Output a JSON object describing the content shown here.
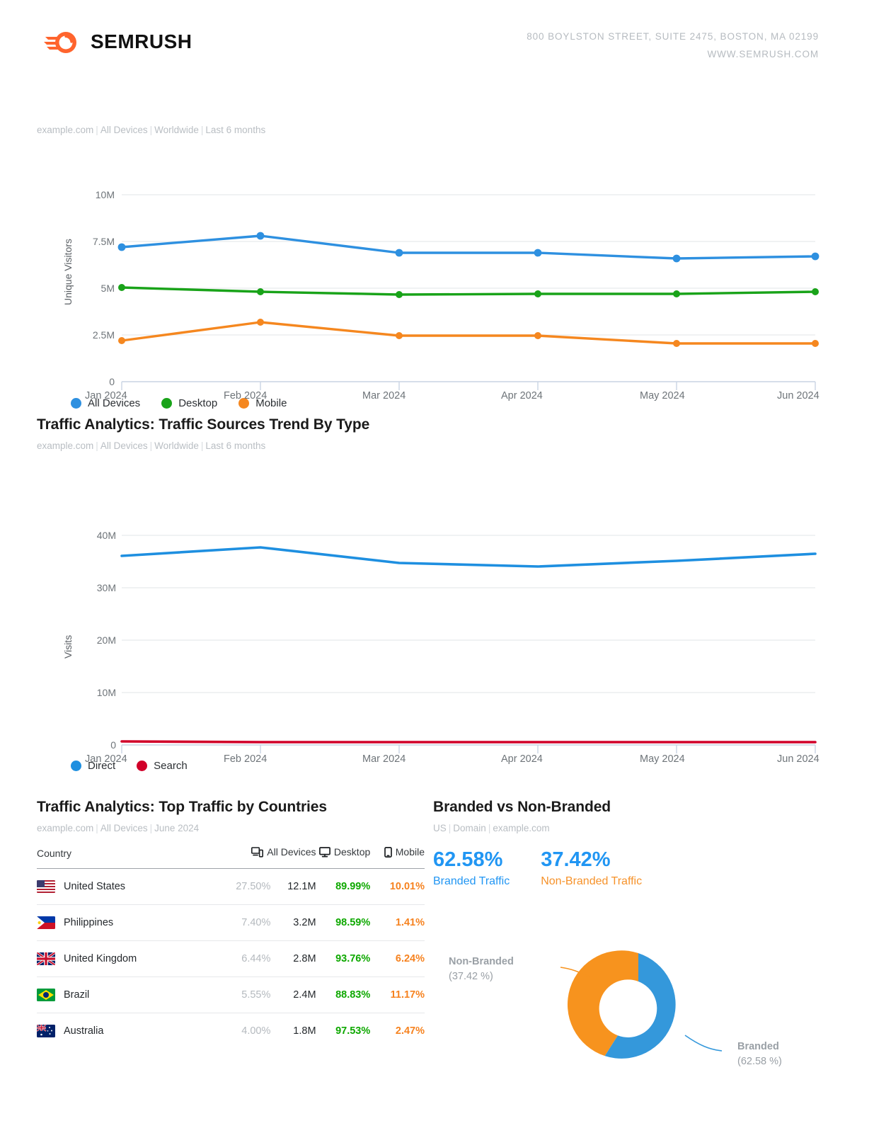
{
  "header": {
    "brand": "SEMRUSH",
    "address_line1": "800 BOYLSTON STREET, SUITE 2475, BOSTON, MA 02199",
    "address_line2": "WWW.SEMRUSH.COM"
  },
  "visitors_section": {
    "subtitle_parts": [
      "example.com",
      "All Devices",
      "Worldwide",
      "Last 6 months"
    ]
  },
  "sources_section": {
    "title": "Traffic Analytics: Traffic Sources Trend By Type",
    "subtitle_parts": [
      "example.com",
      "All Devices",
      "Worldwide",
      "Last 6 months"
    ]
  },
  "countries_section": {
    "title": "Traffic Analytics: Top Traffic by Countries",
    "subtitle_parts": [
      "example.com",
      "All Devices",
      "June 2024"
    ],
    "columns": [
      "Country",
      "All Devices",
      "Desktop",
      "Mobile"
    ],
    "column_icons": [
      "",
      "all-devices-icon",
      "desktop-icon",
      "mobile-icon"
    ],
    "rows": [
      {
        "country": "United States",
        "flag": "us",
        "share": "27.50%",
        "visits": "12.1M",
        "desktop": "89.99%",
        "mobile": "10.01%"
      },
      {
        "country": "Philippines",
        "flag": "ph",
        "share": "7.40%",
        "visits": "3.2M",
        "desktop": "98.59%",
        "mobile": "1.41%"
      },
      {
        "country": "United Kingdom",
        "flag": "gb",
        "share": "6.44%",
        "visits": "2.8M",
        "desktop": "93.76%",
        "mobile": "6.24%"
      },
      {
        "country": "Brazil",
        "flag": "br",
        "share": "5.55%",
        "visits": "2.4M",
        "desktop": "88.83%",
        "mobile": "11.17%"
      },
      {
        "country": "Australia",
        "flag": "au",
        "share": "4.00%",
        "visits": "1.8M",
        "desktop": "97.53%",
        "mobile": "2.47%"
      }
    ]
  },
  "branded_section": {
    "title": "Branded vs Non-Branded",
    "subtitle_parts": [
      "US",
      "Domain",
      "example.com"
    ],
    "kpi_branded_value": "62.58%",
    "kpi_branded_label": "Branded Traffic",
    "kpi_nonbranded_value": "37.42%",
    "kpi_nonbranded_label": "Non-Branded Traffic",
    "callout_nonbranded_name": "Non-Branded",
    "callout_nonbranded_pct": "(37.42 %)",
    "callout_branded_name": "Branded",
    "callout_branded_pct": "(62.58 %)"
  },
  "colors": {
    "all_devices": "#2e90e0",
    "desktop": "#19a319",
    "mobile": "#f5871f",
    "direct": "#1e8fe0",
    "search": "#d10029",
    "branded": "#3498db",
    "non_branded": "#f7931e",
    "brand_orange": "#ff642d"
  },
  "chart_data": [
    {
      "type": "line",
      "title": "",
      "xlabel": "",
      "ylabel": "Unique Visitors",
      "x": [
        "Jan 2024",
        "Feb 2024",
        "Mar 2024",
        "Apr 2024",
        "May 2024",
        "Jun 2024"
      ],
      "ytick_labels": [
        "0",
        "2.5M",
        "5M",
        "7.5M",
        "10M"
      ],
      "ytick_values": [
        0,
        2500000,
        5000000,
        7500000,
        10000000
      ],
      "ylim": [
        0,
        10000000
      ],
      "grid": true,
      "legend_position": "bottom-left",
      "markers": true,
      "series": [
        {
          "name": "All Devices",
          "color": "#2e90e0",
          "values": [
            7200000,
            7800000,
            6900000,
            6900000,
            6600000,
            6700000
          ]
        },
        {
          "name": "Desktop",
          "color": "#19a319",
          "values": [
            5050000,
            4800000,
            4650000,
            4700000,
            4700000,
            4800000
          ]
        },
        {
          "name": "Mobile",
          "color": "#f5871f",
          "values": [
            2200000,
            3200000,
            2450000,
            2450000,
            2050000,
            2050000
          ]
        }
      ]
    },
    {
      "type": "line",
      "title": "Traffic Analytics: Traffic Sources Trend By Type",
      "xlabel": "",
      "ylabel": "Visits",
      "x": [
        "Jan 2024",
        "Feb 2024",
        "Mar 2024",
        "Apr 2024",
        "May 2024",
        "Jun 2024"
      ],
      "ytick_labels": [
        "0",
        "10M",
        "20M",
        "30M",
        "40M"
      ],
      "ytick_values": [
        0,
        10000000,
        20000000,
        30000000,
        40000000
      ],
      "ylim": [
        0,
        40000000
      ],
      "grid": true,
      "legend_position": "bottom-left",
      "markers": false,
      "series": [
        {
          "name": "Direct",
          "color": "#1e8fe0",
          "values": [
            36000000,
            37600000,
            34700000,
            34100000,
            35100000,
            36500000
          ]
        },
        {
          "name": "Search",
          "color": "#d10029",
          "values": [
            700000,
            650000,
            620000,
            600000,
            600000,
            620000
          ]
        }
      ]
    },
    {
      "type": "pie",
      "title": "Branded vs Non-Branded",
      "labels": [
        "Branded",
        "Non-Branded"
      ],
      "values": [
        62.58,
        37.42
      ],
      "colors": [
        "#3498db",
        "#f7931e"
      ],
      "donut": true
    }
  ]
}
